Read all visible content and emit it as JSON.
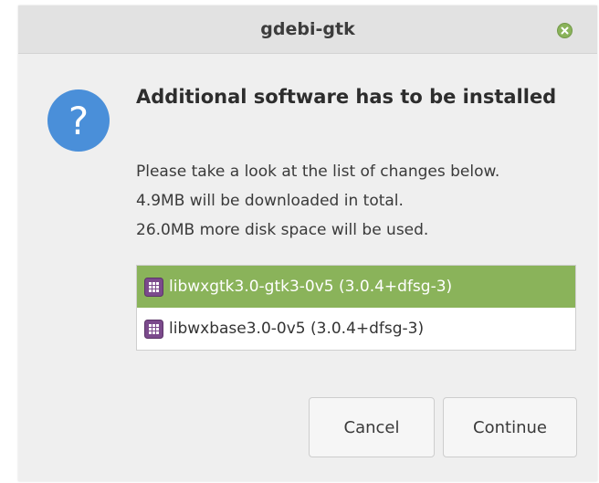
{
  "window": {
    "title": "gdebi-gtk"
  },
  "dialog": {
    "icon": "question-icon",
    "heading": "Additional software has to be installed",
    "description_lines": [
      "Please take a look at the list of changes below.",
      "4.9MB will be downloaded in total.",
      "26.0MB more disk space will be used."
    ]
  },
  "packages": [
    {
      "label": "libwxgtk3.0-gtk3-0v5 (3.0.4+dfsg-3)",
      "selected": true,
      "icon": "package-icon"
    },
    {
      "label": "libwxbase3.0-0v5 (3.0.4+dfsg-3)",
      "selected": false,
      "icon": "package-icon"
    }
  ],
  "buttons": {
    "cancel_label": "Cancel",
    "continue_label": "Continue"
  },
  "colors": {
    "accent": "#8ab35a",
    "question_icon": "#4a8fd9",
    "package_icon": "#7b4a8c"
  }
}
